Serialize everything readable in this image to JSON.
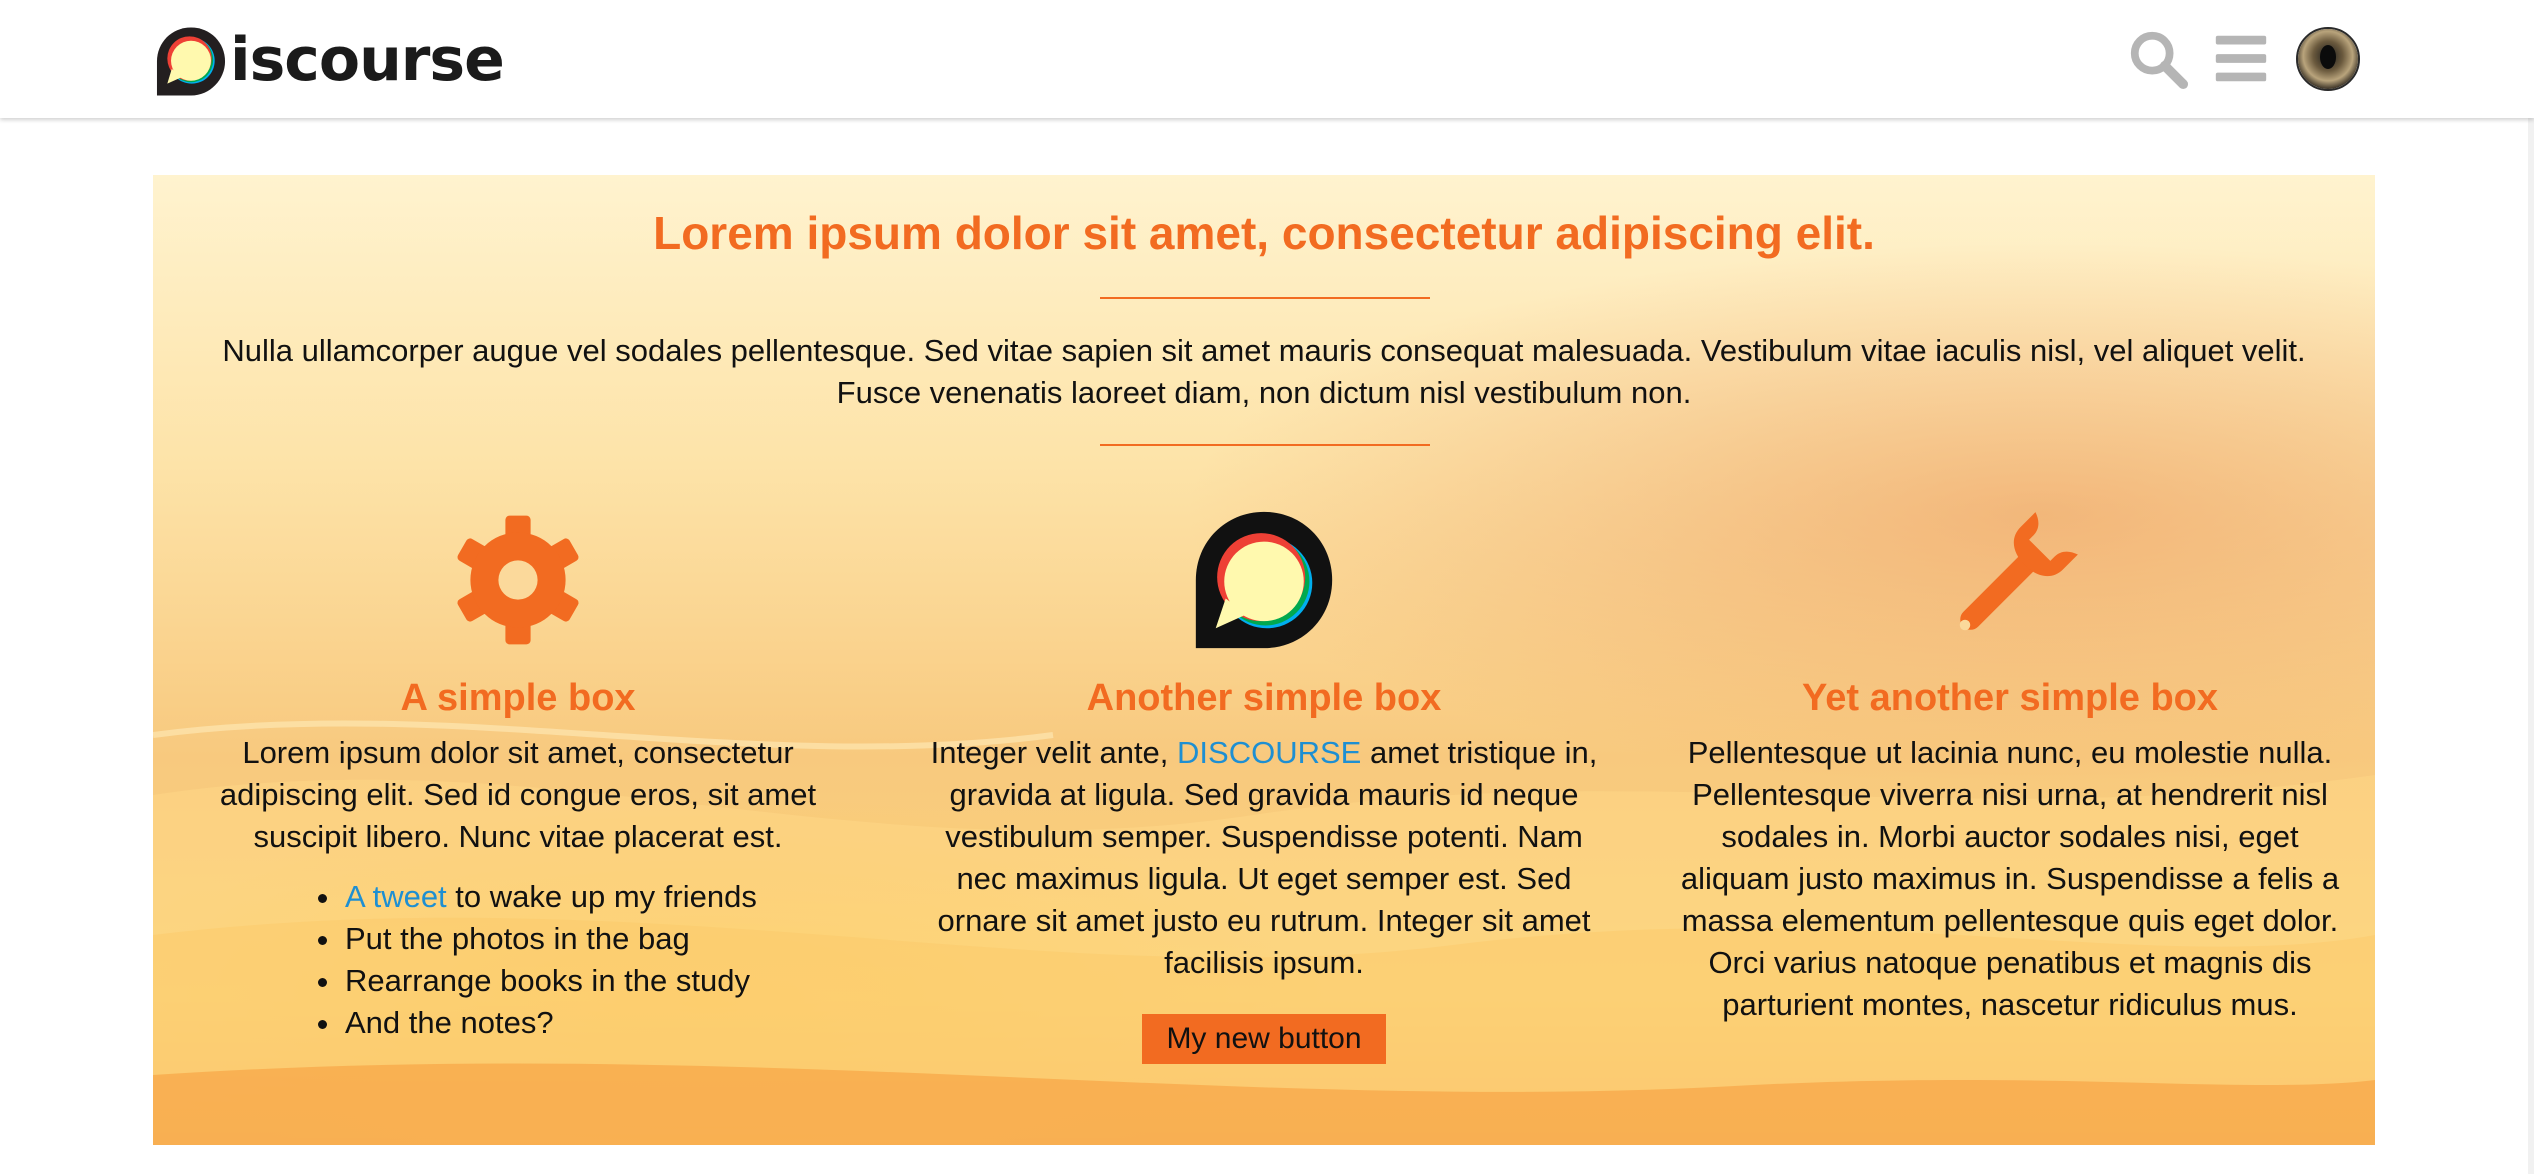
{
  "header": {
    "logo_text": "iscourse",
    "icons": [
      "discourse-logo-icon",
      "search-icon",
      "hamburger-menu-icon",
      "user-avatar"
    ]
  },
  "banner": {
    "title": "Lorem ipsum dolor sit amet, consectetur adipiscing elit.",
    "intro": "Nulla ullamcorper augue vel sodales pellentesque. Sed vitae sapien sit amet mauris consequat malesuada. Vestibulum vitae iaculis nisl, vel aliquet velit. Fusce venenatis laoreet diam, non dictum nisl vestibulum non.",
    "boxes": [
      {
        "icon": "gear-icon",
        "title": "A simple box",
        "text": "Lorem ipsum dolor sit amet, consectetur adipiscing elit. Sed id congue eros, sit amet suscipit libero. Nunc vitae placerat est.",
        "list": [
          {
            "link": "A tweet",
            "rest": " to wake up my friends"
          },
          {
            "text": "Put the photos in the bag"
          },
          {
            "text": "Rearrange books in the study"
          },
          {
            "text": "And the notes?"
          }
        ]
      },
      {
        "icon": "discourse-logo-icon",
        "title": "Another simple box",
        "text_before": "Integer velit ante, ",
        "link": "DISCOURSE",
        "text_after": " amet tristique in, gravida at ligula. Sed gravida mauris id neque vestibulum semper. Suspendisse potenti. Nam nec maximus ligula. Ut eget semper est. Sed ornare sit amet justo eu rutrum. Integer sit amet facilisis ipsum.",
        "button": "My new button"
      },
      {
        "icon": "wrench-icon",
        "title": "Yet another simple box",
        "text": "Pellentesque ut lacinia nunc, eu molestie nulla. Pellentesque viverra nisi urna, at hendrerit nisl sodales in. Morbi auctor sodales nisi, eget aliquam justo maximus in. Suspendisse a felis a massa elementum pellentesque quis eget dolor. Orci varius natoque penatibus et magnis dis parturient montes, nascetur ridiculus mus."
      }
    ]
  },
  "colors": {
    "accent": "#f26b21",
    "link": "#1e8fd2",
    "header_icon": "#b5b5b5"
  }
}
